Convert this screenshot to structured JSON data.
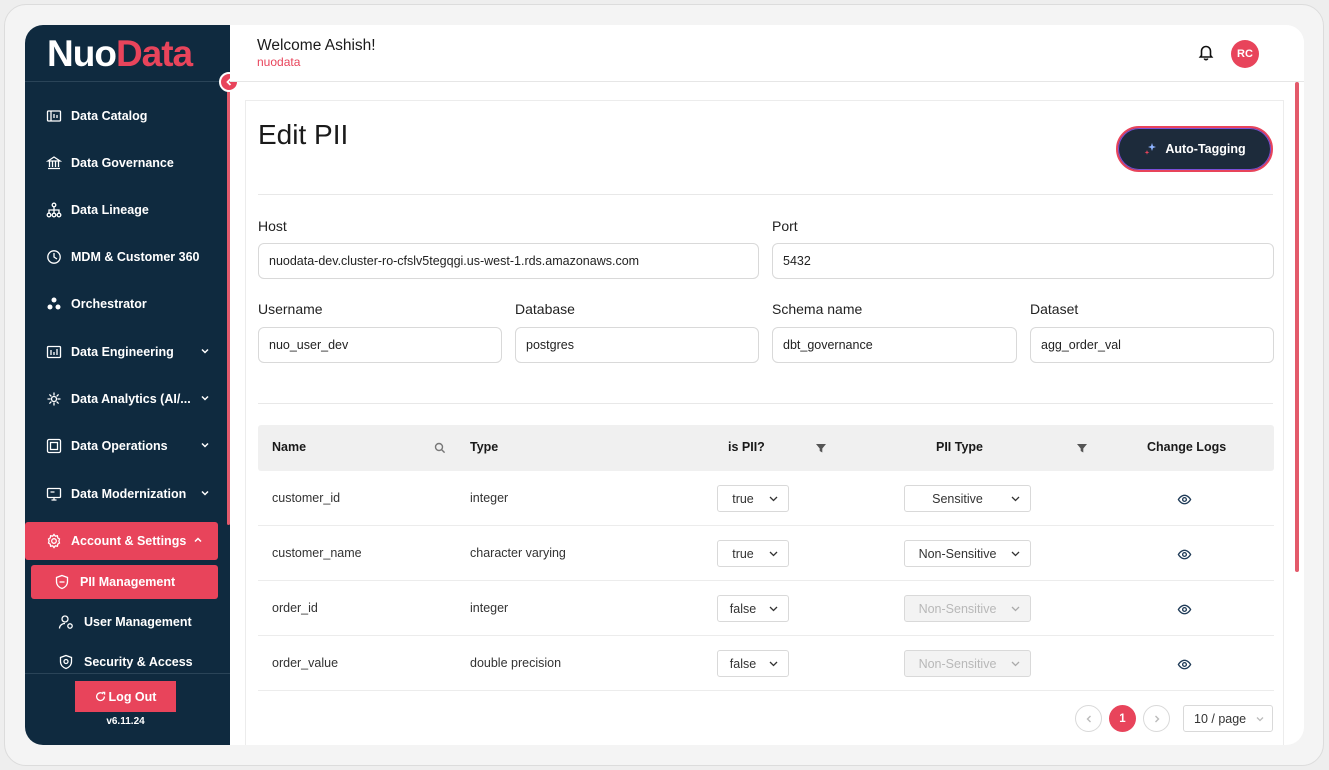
{
  "brand": {
    "logo_part1": "Nuo",
    "logo_part2": "Data",
    "accent": "#e8445b",
    "sidebar_bg": "#0f2a3f"
  },
  "header": {
    "welcome": "Welcome Ashish!",
    "org": "nuodata",
    "avatar_initials": "RC"
  },
  "sidebar": {
    "items": [
      {
        "label": "Data Catalog",
        "icon": "catalog-icon"
      },
      {
        "label": "Data Governance",
        "icon": "governance-icon"
      },
      {
        "label": "Data Lineage",
        "icon": "lineage-icon"
      },
      {
        "label": "MDM & Customer 360",
        "icon": "mdm-icon"
      },
      {
        "label": "Orchestrator",
        "icon": "orchestrator-icon"
      },
      {
        "label": "Data Engineering",
        "icon": "engineering-icon"
      },
      {
        "label": "Data Analytics (AI/...",
        "icon": "analytics-icon"
      },
      {
        "label": "Data Operations",
        "icon": "operations-icon"
      },
      {
        "label": "Data Modernization",
        "icon": "modernization-icon"
      },
      {
        "label": "Account & Settings",
        "icon": "settings-icon"
      }
    ],
    "sub_items": [
      {
        "label": "PII Management",
        "icon": "pii-shield-icon"
      },
      {
        "label": "User Management",
        "icon": "user-icon"
      },
      {
        "label": "Security & Access",
        "icon": "security-icon"
      }
    ],
    "logout": "Log Out",
    "version": "v6.11.24"
  },
  "page": {
    "title": "Edit PII",
    "auto_tagging": "Auto-Tagging",
    "fields": {
      "host_label": "Host",
      "host_value": "nuodata-dev.cluster-ro-cfslv5tegqgi.us-west-1.rds.amazonaws.com",
      "port_label": "Port",
      "port_value": "5432",
      "username_label": "Username",
      "username_value": "nuo_user_dev",
      "database_label": "Database",
      "database_value": "postgres",
      "schema_label": "Schema name",
      "schema_value": "dbt_governance",
      "dataset_label": "Dataset",
      "dataset_value": "agg_order_val"
    }
  },
  "table": {
    "headers": {
      "name": "Name",
      "type": "Type",
      "is_pii": "is PII?",
      "pii_type": "PII Type",
      "change_logs": "Change Logs"
    },
    "rows": [
      {
        "name": "customer_id",
        "type": "integer",
        "is_pii": "true",
        "pii_type": "Sensitive"
      },
      {
        "name": "customer_name",
        "type": "character varying",
        "is_pii": "true",
        "pii_type": "Non-Sensitive"
      },
      {
        "name": "order_id",
        "type": "integer",
        "is_pii": "false",
        "pii_type": "Non-Sensitive"
      },
      {
        "name": "order_value",
        "type": "double precision",
        "is_pii": "false",
        "pii_type": "Non-Sensitive"
      }
    ]
  },
  "pagination": {
    "current_page": "1",
    "page_size": "10 / page"
  }
}
